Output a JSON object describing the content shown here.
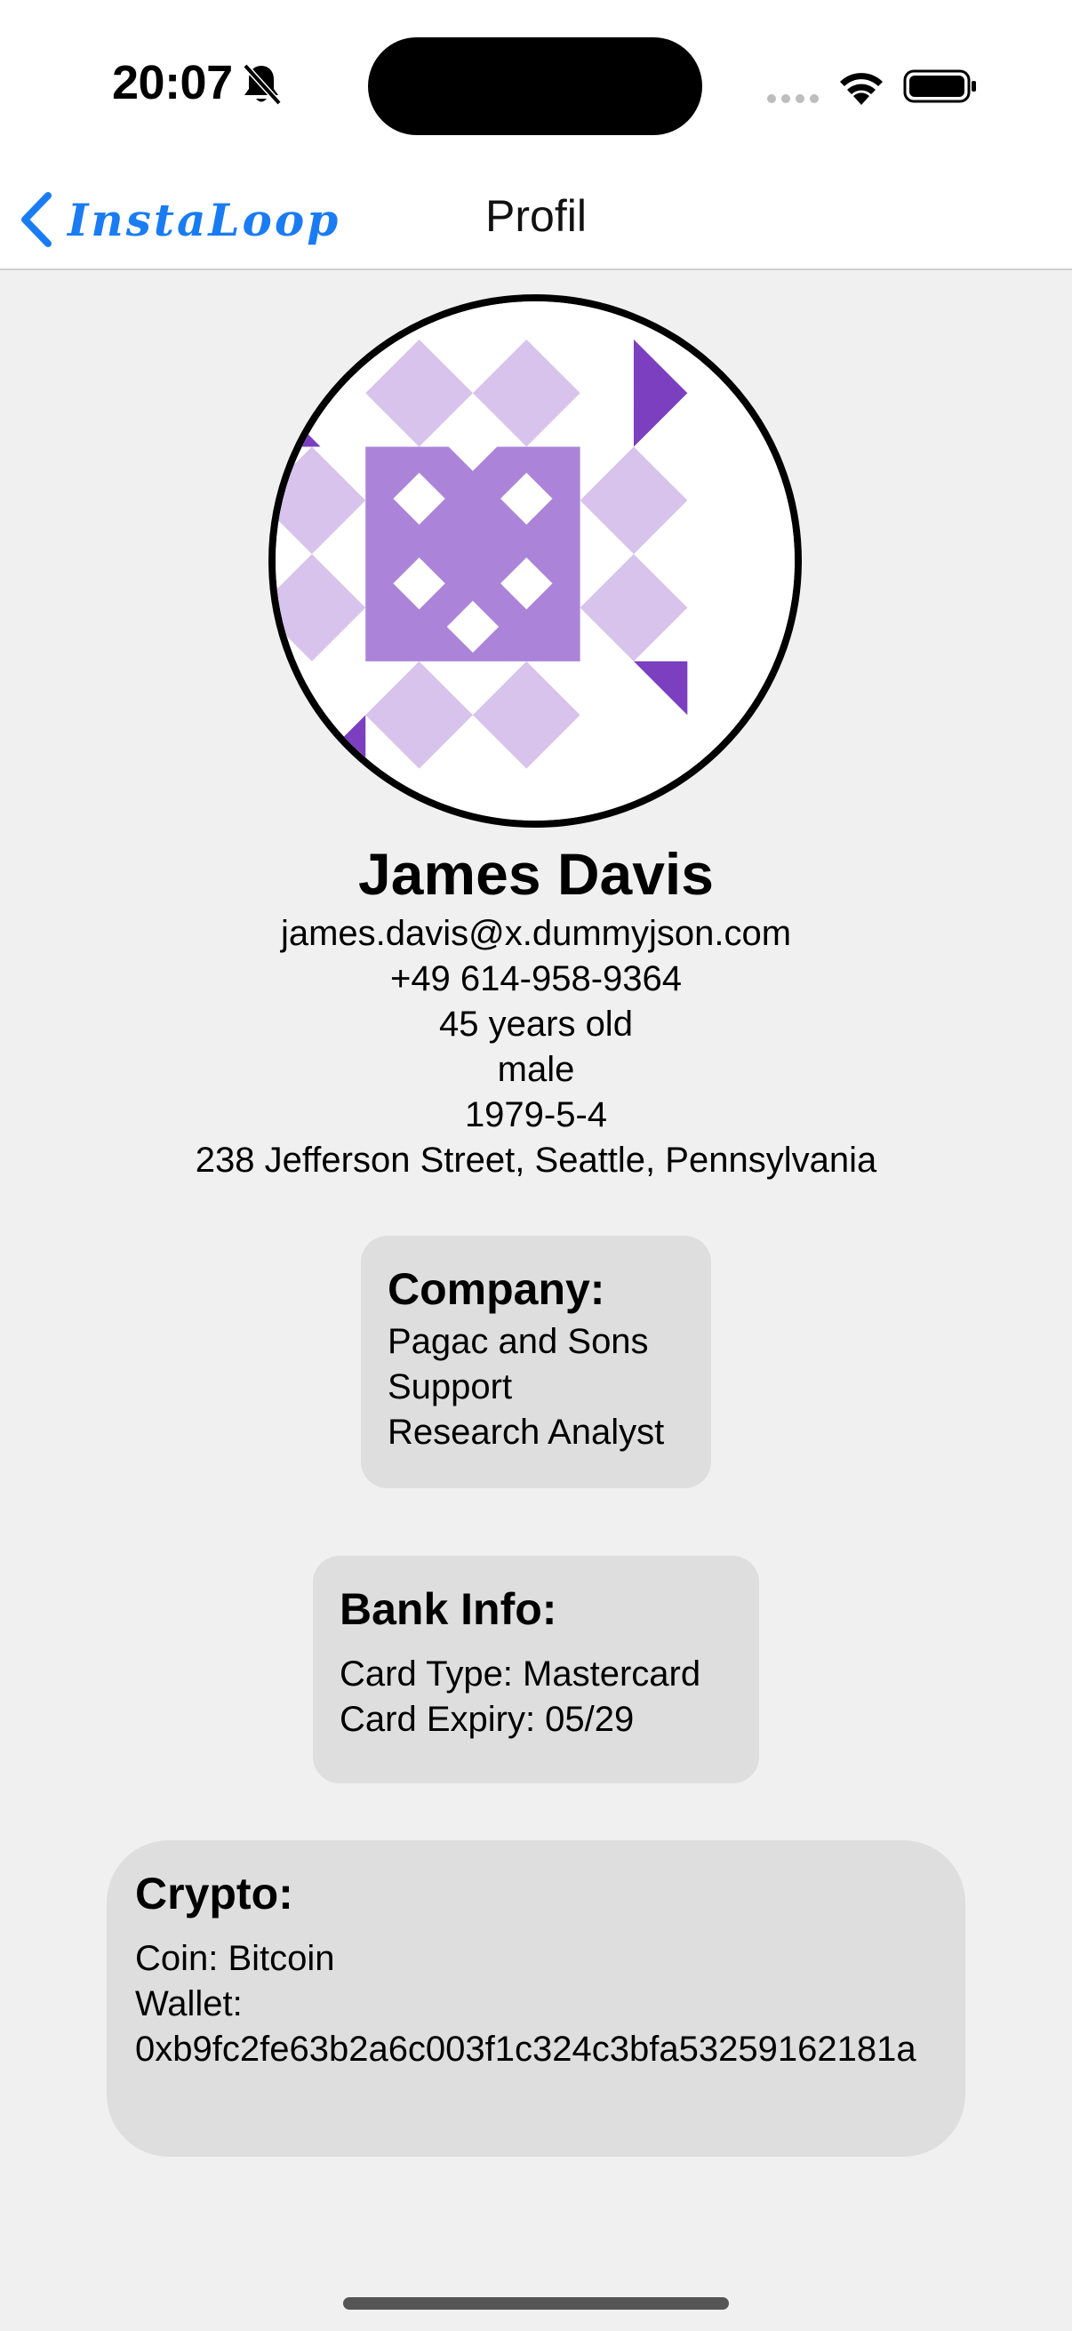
{
  "status_bar": {
    "time": "20:07",
    "icons": [
      "bell-slash-icon",
      "cellular-signal-icon",
      "wifi-icon",
      "battery-icon"
    ]
  },
  "nav": {
    "back_label": "InstaLoop",
    "title": "Profil",
    "accent_color": "#1a7cf2"
  },
  "profile": {
    "name": "James Davis",
    "email": "james.davis@x.dummyjson.com",
    "phone": "+49 614-958-9364",
    "age": "45 years old",
    "gender": "male",
    "birth_date": "1979-5-4",
    "address": "238 Jefferson Street, Seattle, Pennsylvania",
    "avatar_colors": [
      "#7b3fbf",
      "#ab84d9",
      "#d7c3eb"
    ]
  },
  "company": {
    "title": "Company:",
    "name": "Pagac and Sons",
    "department": "Support",
    "role": "Research Analyst"
  },
  "bank": {
    "title": "Bank Info:",
    "card_type": "Card Type: Mastercard",
    "card_expiry": "Card Expiry: 05/29"
  },
  "crypto": {
    "title": "Crypto:",
    "coin": "Coin: Bitcoin",
    "wallet_label": "Wallet:",
    "wallet": "0xb9fc2fe63b2a6c003f1c324c3bfa53259162181a"
  }
}
